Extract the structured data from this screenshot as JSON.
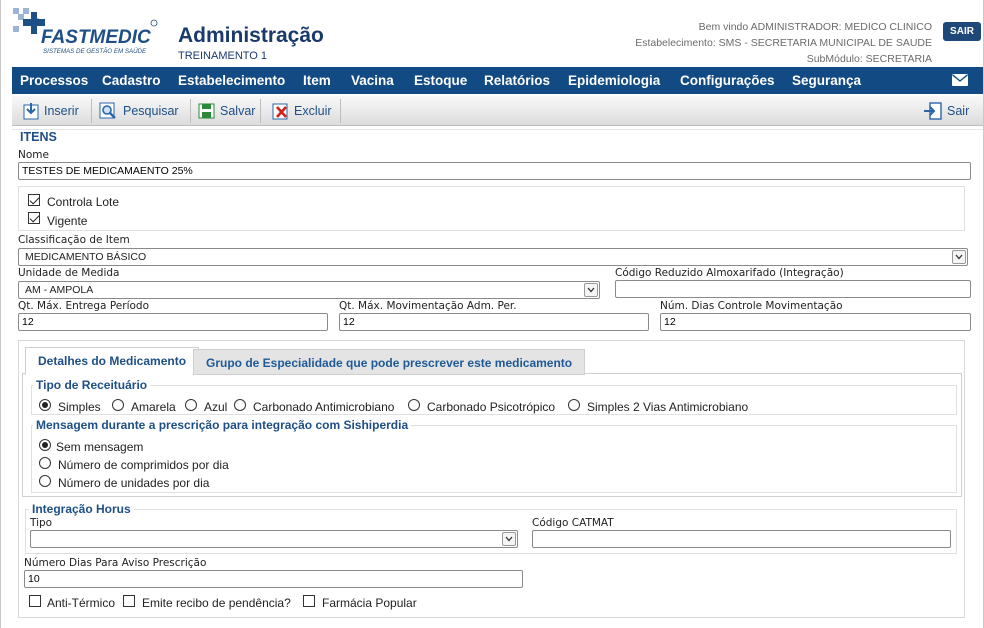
{
  "header": {
    "logo_text": "FASTMEDIC",
    "logo_tagline": "SISTEMAS DE GESTÃO EM SAÚDE",
    "title": "Administração",
    "subtitle": "TREINAMENTO 1",
    "welcome": "Bem vindo ADMINISTRADOR: MEDICO CLINICO",
    "establishment": "Estabelecimento: SMS - SECRETARIA MUNICIPAL DE SAUDE",
    "submodule": "SubMódulo: SECRETARIA",
    "logout_label": "SAIR"
  },
  "nav": {
    "items": [
      "Processos",
      "Cadastro",
      "Estabelecimento",
      "Item",
      "Vacina",
      "Estoque",
      "Relatórios",
      "Epidemiologia",
      "Configurações",
      "Segurança"
    ]
  },
  "toolbar": {
    "insert": "Inserir",
    "search": "Pesquisar",
    "save": "Salvar",
    "delete": "Excluir",
    "exit": "Sair"
  },
  "form": {
    "section_title": "ITENS",
    "nome_label": "Nome",
    "nome_value": "TESTES DE MEDICAMAENTO 25%",
    "controla_lote_label": "Controla Lote",
    "controla_lote_checked": true,
    "vigente_label": "Vigente",
    "vigente_checked": true,
    "classificacao_label": "Classificação de Item",
    "classificacao_value": "MEDICAMENTO BÁSICO",
    "unidade_label": "Unidade de Medida",
    "unidade_value": "AM - AMPOLA",
    "codigo_reduzido_label": "Código Reduzido Almoxarifado (Integração)",
    "codigo_reduzido_value": "",
    "qt_max_entrega_label": "Qt. Máx. Entrega Período",
    "qt_max_entrega_value": "12",
    "qt_max_mov_label": "Qt. Máx. Movimentação Adm. Per.",
    "qt_max_mov_value": "12",
    "num_dias_label": "Núm. Dias Controle Movimentação",
    "num_dias_value": "12"
  },
  "tabs": [
    {
      "label": "Detalhes do Medicamento",
      "active": true
    },
    {
      "label": "Grupo de Especialidade que pode prescrever este medicamento",
      "active": false
    }
  ],
  "receituario": {
    "title": "Tipo de Receituário",
    "options": [
      "Simples",
      "Amarela",
      "Azul",
      "Carbonado Antimicrobiano",
      "Carbonado Psicotrópico",
      "Simples 2 Vias Antimicrobiano"
    ],
    "selected": "Simples"
  },
  "mensagem": {
    "title": "Mensagem durante a prescrição para integração com Sishiperdia",
    "options": [
      "Sem mensagem",
      "Número de comprimidos por dia",
      "Número de unidades por dia"
    ],
    "selected": "Sem mensagem"
  },
  "horus": {
    "title": "Integração Horus",
    "tipo_label": "Tipo",
    "tipo_value": "",
    "catmat_label": "Código CATMAT",
    "catmat_value": ""
  },
  "aviso": {
    "label": "Número Dias Para Aviso Prescrição",
    "value": "10"
  },
  "flags": {
    "anti_termico_label": "Anti-Térmico",
    "anti_termico_checked": false,
    "recibo_label": "Emite recibo de pendência?",
    "recibo_checked": false,
    "farmacia_label": "Farmácia Popular",
    "farmacia_checked": false
  },
  "colors": {
    "nav_bg": "#124a84",
    "title_blue": "#1a3a6e",
    "accent_blue": "#1e4f86"
  }
}
